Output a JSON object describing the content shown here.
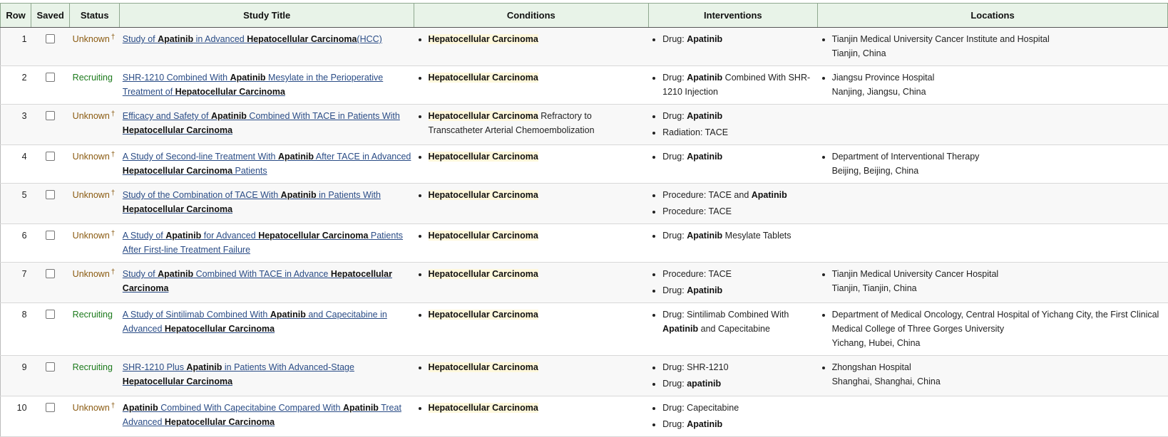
{
  "headers": {
    "row": "Row",
    "saved": "Saved",
    "status": "Status",
    "title": "Study Title",
    "conditions": "Conditions",
    "interventions": "Interventions",
    "locations": "Locations"
  },
  "colors": {
    "header_bg": "#e8f3e8",
    "link": "#2a4c86",
    "status_unknown": "#8a5a10",
    "status_recruiting": "#1c7a1c",
    "highlight_bg": "#fff8dc"
  },
  "rows": [
    {
      "num": "1",
      "status": "Unknown",
      "status_marker": "†",
      "status_type": "unknown",
      "title": [
        [
          "Study of ",
          false
        ],
        [
          "Apatinib",
          true
        ],
        [
          " in Advanced ",
          false
        ],
        [
          "Hepatocellular Carcinoma",
          true
        ],
        [
          "(HCC)",
          false
        ]
      ],
      "conditions": [
        [
          [
            "Hepatocellular Carcinoma",
            true
          ]
        ]
      ],
      "interventions": [
        [
          [
            "Drug: ",
            false
          ],
          [
            "Apatinib",
            true
          ]
        ]
      ],
      "locations": [
        {
          "name": "Tianjin Medical University Cancer Institute and Hospital",
          "place": "Tianjin, China"
        }
      ]
    },
    {
      "num": "2",
      "status": "Recruiting",
      "status_marker": "",
      "status_type": "recruiting",
      "title": [
        [
          "SHR-1210 Combined With ",
          false
        ],
        [
          "Apatinib",
          true
        ],
        [
          " Mesylate in the Perioperative Treatment of ",
          false
        ],
        [
          "Hepatocellular Carcinoma",
          true
        ]
      ],
      "conditions": [
        [
          [
            "Hepatocellular Carcinoma",
            true
          ]
        ]
      ],
      "interventions": [
        [
          [
            "Drug: ",
            false
          ],
          [
            "Apatinib",
            true
          ],
          [
            " Combined With SHR-1210 Injection",
            false
          ]
        ]
      ],
      "locations": [
        {
          "name": "Jiangsu Province Hospital",
          "place": "Nanjing, Jiangsu, China"
        }
      ]
    },
    {
      "num": "3",
      "status": "Unknown",
      "status_marker": "†",
      "status_type": "unknown",
      "title": [
        [
          "Efficacy and Safety of ",
          false
        ],
        [
          "Apatinib",
          true
        ],
        [
          " Combined With TACE in Patients With ",
          false
        ],
        [
          "Hepatocellular Carcinoma",
          true
        ]
      ],
      "conditions": [
        [
          [
            "Hepatocellular Carcinoma",
            true
          ],
          [
            " Refractory to Transcatheter Arterial Chemoembolization",
            false
          ]
        ]
      ],
      "interventions": [
        [
          [
            "Drug: ",
            false
          ],
          [
            "Apatinib",
            true
          ]
        ],
        [
          [
            "Radiation: TACE",
            false
          ]
        ]
      ],
      "locations": []
    },
    {
      "num": "4",
      "status": "Unknown",
      "status_marker": "†",
      "status_type": "unknown",
      "title": [
        [
          "A Study of Second-line Treatment With ",
          false
        ],
        [
          "Apatinib",
          true
        ],
        [
          " After TACE in Advanced ",
          false
        ],
        [
          "Hepatocellular Carcinoma",
          true
        ],
        [
          " Patients",
          false
        ]
      ],
      "conditions": [
        [
          [
            "Hepatocellular Carcinoma",
            true
          ]
        ]
      ],
      "interventions": [
        [
          [
            "Drug: ",
            false
          ],
          [
            "Apatinib",
            true
          ]
        ]
      ],
      "locations": [
        {
          "name": "Department of Interventional Therapy",
          "place": "Beijing, Beijing, China"
        }
      ]
    },
    {
      "num": "5",
      "status": "Unknown",
      "status_marker": "†",
      "status_type": "unknown",
      "title": [
        [
          "Study of the Combination of TACE With ",
          false
        ],
        [
          "Apatinib",
          true
        ],
        [
          " in Patients With ",
          false
        ],
        [
          "Hepatocellular Carcinoma",
          true
        ]
      ],
      "conditions": [
        [
          [
            "Hepatocellular Carcinoma",
            true
          ]
        ]
      ],
      "interventions": [
        [
          [
            "Procedure: TACE and ",
            false
          ],
          [
            "Apatinib",
            true
          ]
        ],
        [
          [
            "Procedure: TACE",
            false
          ]
        ]
      ],
      "locations": []
    },
    {
      "num": "6",
      "status": "Unknown",
      "status_marker": "†",
      "status_type": "unknown",
      "title": [
        [
          "A Study of ",
          false
        ],
        [
          "Apatinib",
          true
        ],
        [
          " for Advanced ",
          false
        ],
        [
          "Hepatocellular Carcinoma",
          true
        ],
        [
          " Patients After First-line Treatment Failure",
          false
        ]
      ],
      "conditions": [
        [
          [
            "Hepatocellular Carcinoma",
            true
          ]
        ]
      ],
      "interventions": [
        [
          [
            "Drug: ",
            false
          ],
          [
            "Apatinib",
            true
          ],
          [
            " Mesylate Tablets",
            false
          ]
        ]
      ],
      "locations": []
    },
    {
      "num": "7",
      "status": "Unknown",
      "status_marker": "†",
      "status_type": "unknown",
      "title": [
        [
          "Study of ",
          false
        ],
        [
          "Apatinib",
          true
        ],
        [
          " Combined With TACE in Advance ",
          false
        ],
        [
          "Hepatocellular Carcinoma",
          true
        ]
      ],
      "conditions": [
        [
          [
            "Hepatocellular Carcinoma",
            true
          ]
        ]
      ],
      "interventions": [
        [
          [
            "Procedure: TACE",
            false
          ]
        ],
        [
          [
            "Drug: ",
            false
          ],
          [
            "Apatinib",
            true
          ]
        ]
      ],
      "locations": [
        {
          "name": "Tianjin Medical University Cancer Hospital",
          "place": "Tianjin, Tianjin, China"
        }
      ]
    },
    {
      "num": "8",
      "status": "Recruiting",
      "status_marker": "",
      "status_type": "recruiting",
      "title": [
        [
          "A Study of Sintilimab Combined With ",
          false
        ],
        [
          "Apatinib",
          true
        ],
        [
          " and Capecitabine in Advanced ",
          false
        ],
        [
          "Hepatocellular Carcinoma",
          true
        ]
      ],
      "conditions": [
        [
          [
            "Hepatocellular Carcinoma",
            true
          ]
        ]
      ],
      "interventions": [
        [
          [
            "Drug: Sintilimab Combined With ",
            false
          ],
          [
            "Apatinib",
            true
          ],
          [
            " and Capecitabine",
            false
          ]
        ]
      ],
      "locations": [
        {
          "name": "Department of Medical Oncology, Central Hospital of Yichang City, the First Clinical Medical College of Three Gorges University",
          "place": "Yichang, Hubei, China"
        }
      ]
    },
    {
      "num": "9",
      "status": "Recruiting",
      "status_marker": "",
      "status_type": "recruiting",
      "title": [
        [
          "SHR-1210 Plus ",
          false
        ],
        [
          "Apatinib",
          true
        ],
        [
          " in Patients With Advanced-Stage ",
          false
        ],
        [
          "Hepatocellular Carcinoma",
          true
        ]
      ],
      "conditions": [
        [
          [
            "Hepatocellular Carcinoma",
            true
          ]
        ]
      ],
      "interventions": [
        [
          [
            "Drug: SHR-1210",
            false
          ]
        ],
        [
          [
            "Drug: ",
            false
          ],
          [
            "apatinib",
            true
          ]
        ]
      ],
      "locations": [
        {
          "name": "Zhongshan Hospital",
          "place": "Shanghai, Shanghai, China"
        }
      ]
    },
    {
      "num": "10",
      "status": "Unknown",
      "status_marker": "†",
      "status_type": "unknown",
      "title": [
        [
          "Apatinib",
          true
        ],
        [
          " Combined With Capecitabine Compared With ",
          false
        ],
        [
          "Apatinib",
          true
        ],
        [
          " Treat Advanced ",
          false
        ],
        [
          "Hepatocellular Carcinoma",
          true
        ]
      ],
      "conditions": [
        [
          [
            "Hepatocellular Carcinoma",
            true
          ]
        ]
      ],
      "interventions": [
        [
          [
            "Drug: Capecitabine",
            false
          ]
        ],
        [
          [
            "Drug: ",
            false
          ],
          [
            "Apatinib",
            true
          ]
        ]
      ],
      "locations": []
    }
  ]
}
